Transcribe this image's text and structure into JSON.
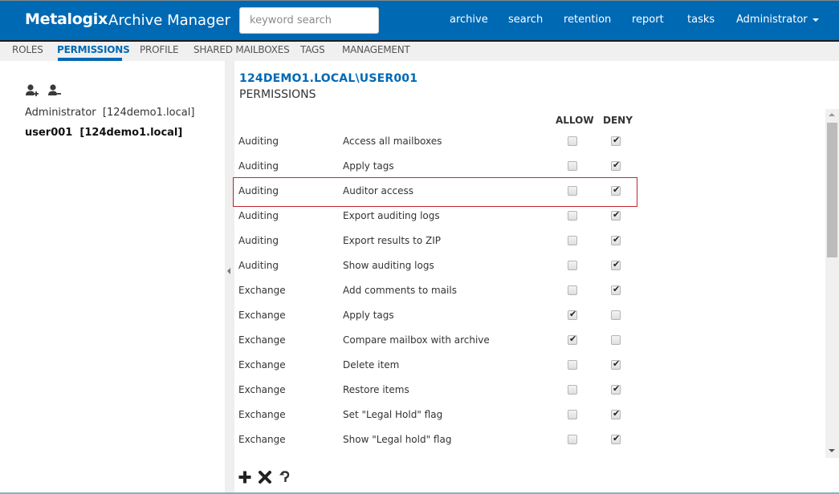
{
  "header": {
    "brand": "Metalogix",
    "app_name": "Archive Manager",
    "search_placeholder": "keyword search",
    "search_value": "",
    "nav": [
      "archive",
      "search",
      "retention",
      "report",
      "tasks"
    ],
    "user_menu": "Administrator",
    "accent_color": "#0069b4"
  },
  "tabs": [
    {
      "label": "ROLES",
      "active": false
    },
    {
      "label": "PERMISSIONS",
      "active": true
    },
    {
      "label": "PROFILE",
      "active": false
    },
    {
      "label": "SHARED MAILBOXES",
      "active": false
    },
    {
      "label": "TAGS",
      "active": false
    },
    {
      "label": "MANAGEMENT",
      "active": false
    }
  ],
  "left_panel": {
    "icons": [
      "add-user-icon",
      "remove-user-icon"
    ],
    "users": [
      {
        "label": "Administrator  [124demo1.local]",
        "selected": false
      },
      {
        "label": "user001  [124demo1.local]",
        "selected": true
      }
    ]
  },
  "main": {
    "title": "124DEMO1.LOCAL\\USER001",
    "subtitle": "PERMISSIONS",
    "columns": {
      "allow": "ALLOW",
      "deny": "DENY"
    },
    "highlighted_row_index": 2,
    "highlight_color": "#c0272d",
    "rows": [
      {
        "category": "Auditing",
        "permission": "Access all mailboxes",
        "allow": false,
        "deny": true
      },
      {
        "category": "Auditing",
        "permission": "Apply tags",
        "allow": false,
        "deny": true
      },
      {
        "category": "Auditing",
        "permission": "Auditor access",
        "allow": false,
        "deny": true
      },
      {
        "category": "Auditing",
        "permission": "Export auditing logs",
        "allow": false,
        "deny": true
      },
      {
        "category": "Auditing",
        "permission": "Export results to ZIP",
        "allow": false,
        "deny": true
      },
      {
        "category": "Auditing",
        "permission": "Show auditing logs",
        "allow": false,
        "deny": true
      },
      {
        "category": "Exchange",
        "permission": "Add comments to mails",
        "allow": false,
        "deny": true
      },
      {
        "category": "Exchange",
        "permission": "Apply tags",
        "allow": true,
        "deny": false
      },
      {
        "category": "Exchange",
        "permission": "Compare mailbox with archive",
        "allow": true,
        "deny": false
      },
      {
        "category": "Exchange",
        "permission": "Delete item",
        "allow": false,
        "deny": true
      },
      {
        "category": "Exchange",
        "permission": "Restore items",
        "allow": false,
        "deny": true
      },
      {
        "category": "Exchange",
        "permission": "Set \"Legal Hold\" flag",
        "allow": false,
        "deny": true
      },
      {
        "category": "Exchange",
        "permission": "Show \"Legal hold\" flag",
        "allow": false,
        "deny": true
      }
    ],
    "toolbar": [
      "add-icon",
      "delete-icon",
      "undo-icon"
    ]
  }
}
